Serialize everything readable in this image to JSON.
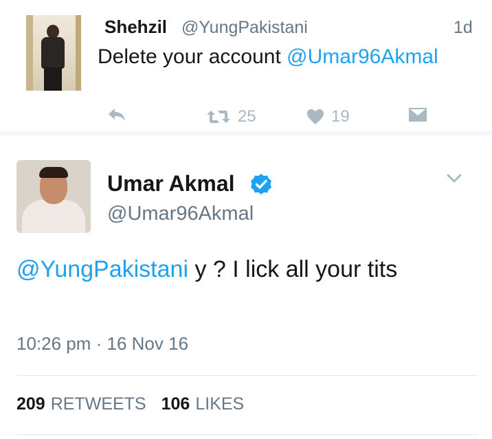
{
  "reply": {
    "name": "Shehzil",
    "handle": "@YungPakistani",
    "time": "1d",
    "text": "Delete your account ",
    "mention": "@Umar96Akmal",
    "retweet_count": "25",
    "like_count": "19"
  },
  "tweet": {
    "name": "Umar Akmal",
    "handle": "@Umar96Akmal",
    "mention": "@YungPakistani",
    "text": " y ? I lick all  your  tits",
    "timestamp": "10:26 pm · 16 Nov 16",
    "retweets": "209",
    "retweets_label": "RETWEETS",
    "likes": "106",
    "likes_label": "LIKES"
  },
  "icons": {
    "reply": "reply-icon",
    "retweet": "retweet-icon",
    "like": "heart-icon",
    "dm": "envelope-icon",
    "verified": "verified-badge-icon",
    "more": "chevron-down-icon"
  },
  "colors": {
    "accent": "#1da1f2",
    "secondary_text": "#657786",
    "action_icons": "#aab8c2"
  }
}
